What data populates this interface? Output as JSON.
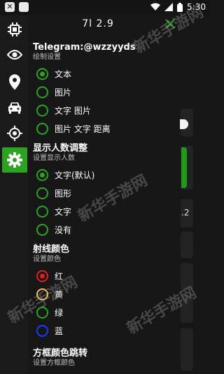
{
  "status_bar": {
    "time": "5:30"
  },
  "header": {
    "title": "7l 2.9"
  },
  "sidebar": {
    "items": [
      {
        "icon": "chip-icon",
        "active": false
      },
      {
        "icon": "eye-icon",
        "active": false
      },
      {
        "icon": "location-pin-icon",
        "active": false
      },
      {
        "icon": "car-icon",
        "active": false
      },
      {
        "icon": "crosshair-icon",
        "active": false
      },
      {
        "icon": "gear-icon",
        "active": true
      }
    ]
  },
  "sections": {
    "draw": {
      "title": "Telegram:@wzzyyds",
      "subtitle": "绘制设置",
      "options": [
        {
          "label": "文本",
          "selected": true
        },
        {
          "label": "图片",
          "selected": false
        },
        {
          "label": "文字 图片",
          "selected": false
        },
        {
          "label": "图片 文字 距离",
          "selected": false
        }
      ]
    },
    "count": {
      "title": "显示人数调整",
      "subtitle": "设置显示人数",
      "options": [
        {
          "label": "文字(默认)",
          "selected": true
        },
        {
          "label": "图形",
          "selected": false
        },
        {
          "label": "文字",
          "selected": false
        },
        {
          "label": "没有",
          "selected": false
        }
      ]
    },
    "ray": {
      "title": "射线颜色",
      "subtitle": "设置颜色",
      "options": [
        {
          "label": "红",
          "color": "#e02020",
          "selected": true
        },
        {
          "label": "黄",
          "color": "#f0c060",
          "selected": false
        },
        {
          "label": "绿",
          "color": "#2ba320",
          "selected": false
        },
        {
          "label": "蓝",
          "color": "#1a3cff",
          "selected": false
        }
      ]
    },
    "box": {
      "title": "方框颜色跳转",
      "subtitle": "设置方框颜色"
    }
  },
  "background": {
    "number_fragment": ".2"
  },
  "watermark": {
    "text": "新华手游网"
  },
  "colors": {
    "accent": "#2ba320",
    "background": "#171717"
  }
}
